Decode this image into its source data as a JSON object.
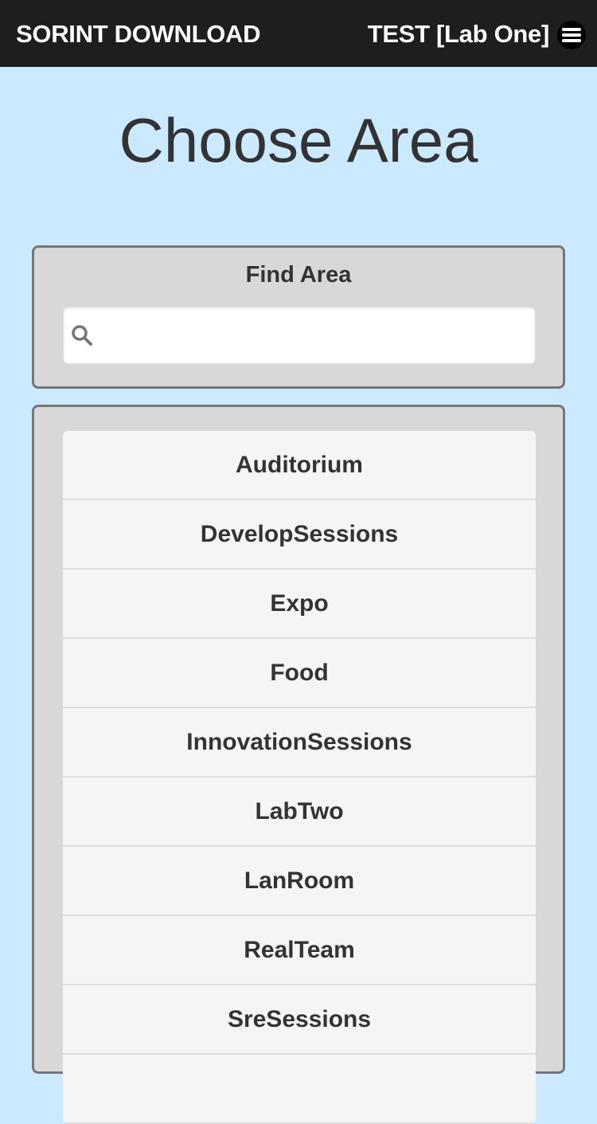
{
  "header": {
    "brand": "SORINT DOWNLOAD",
    "context": "TEST [Lab One]",
    "menu_icon": "hamburger-menu-icon",
    "background_color": "#1e1e1e"
  },
  "main": {
    "title": "Choose Area",
    "background_color": "#cceaff"
  },
  "search": {
    "label": "Find Area",
    "value": "",
    "placeholder": "",
    "icon": "search-icon"
  },
  "areas": [
    {
      "label": "Auditorium"
    },
    {
      "label": "DevelopSessions"
    },
    {
      "label": "Expo"
    },
    {
      "label": "Food"
    },
    {
      "label": "InnovationSessions"
    },
    {
      "label": "LabTwo"
    },
    {
      "label": "LanRoom"
    },
    {
      "label": "RealTeam"
    },
    {
      "label": "SreSessions"
    },
    {
      "label": ""
    }
  ]
}
